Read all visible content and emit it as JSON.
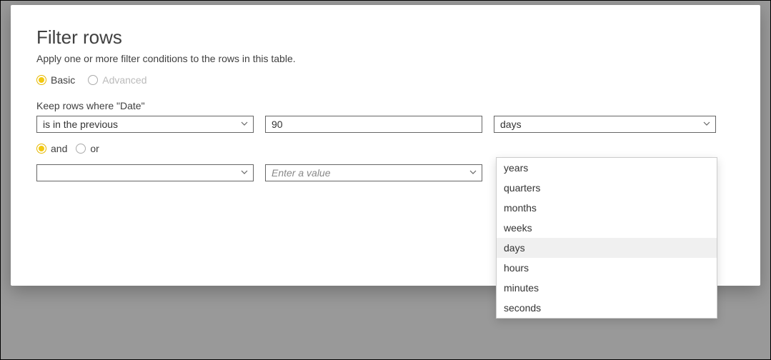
{
  "title": "Filter rows",
  "subtitle": "Apply one or more filter conditions to the rows in this table.",
  "mode": {
    "basic": "Basic",
    "advanced": "Advanced"
  },
  "keep_label": "Keep rows where \"Date\"",
  "row1": {
    "operator": "is in the previous",
    "value": "90",
    "unit": "days"
  },
  "combiner": {
    "and": "and",
    "or": "or"
  },
  "row2": {
    "operator": "",
    "value_placeholder": "Enter a value"
  },
  "unit_options": [
    "years",
    "quarters",
    "months",
    "weeks",
    "days",
    "hours",
    "minutes",
    "seconds"
  ],
  "unit_selected_index": 4
}
